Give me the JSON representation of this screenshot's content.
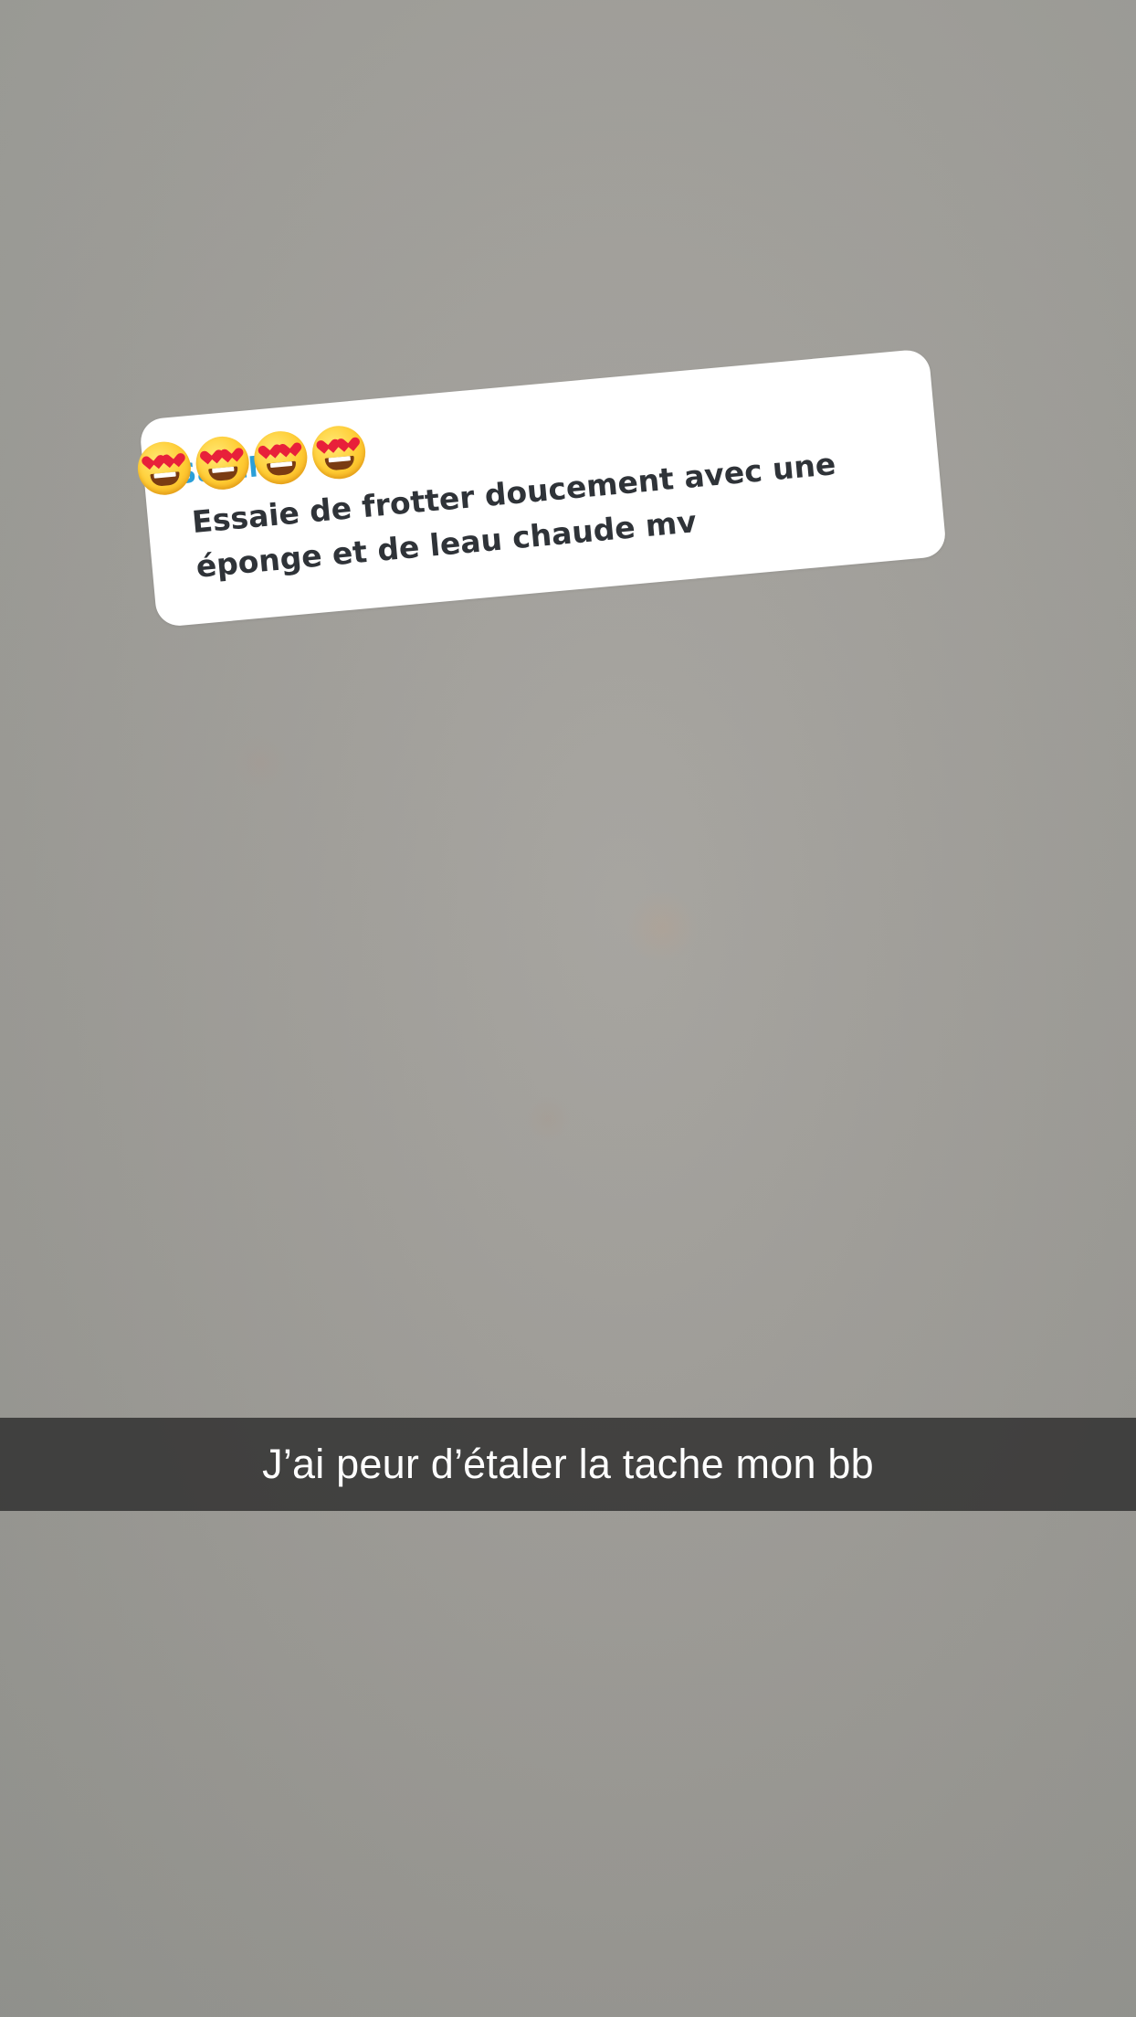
{
  "reply_sticker": {
    "username": "Sarah",
    "emojis": [
      "heart-eyes-emoji",
      "heart-eyes-emoji",
      "heart-eyes-emoji",
      "heart-eyes-emoji"
    ],
    "message": "Essaie de frotter doucement avec une\néponge et de leau chaude mv"
  },
  "caption": {
    "text": "J’ai peur d’étaler la tache mon bb"
  },
  "colors": {
    "card_background": "#ffffff",
    "message_text": "#2f3338",
    "username_accent": "#2b9fd8",
    "caption_bar": "#282828",
    "caption_text": "#ffffff"
  }
}
